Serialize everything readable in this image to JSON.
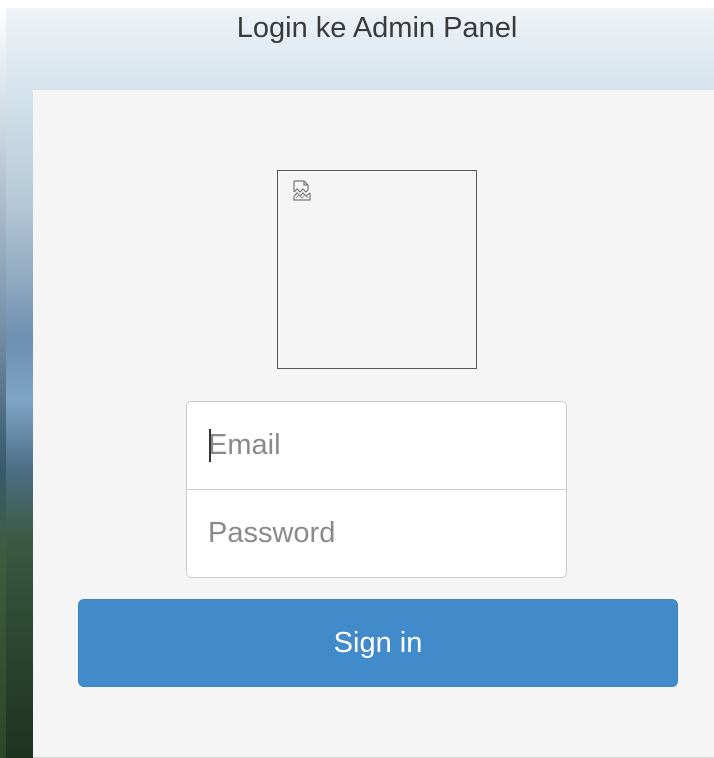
{
  "header": {
    "title": "Login ke Admin Panel"
  },
  "login_form": {
    "logo_image": "broken-image",
    "email": {
      "value": "",
      "placeholder": "Email"
    },
    "password": {
      "value": "",
      "placeholder": "Password"
    },
    "submit_label": "Sign in"
  },
  "colors": {
    "primary_button": "#428bca",
    "panel_background": "#f5f5f5",
    "title_text": "#3a3a3a"
  }
}
